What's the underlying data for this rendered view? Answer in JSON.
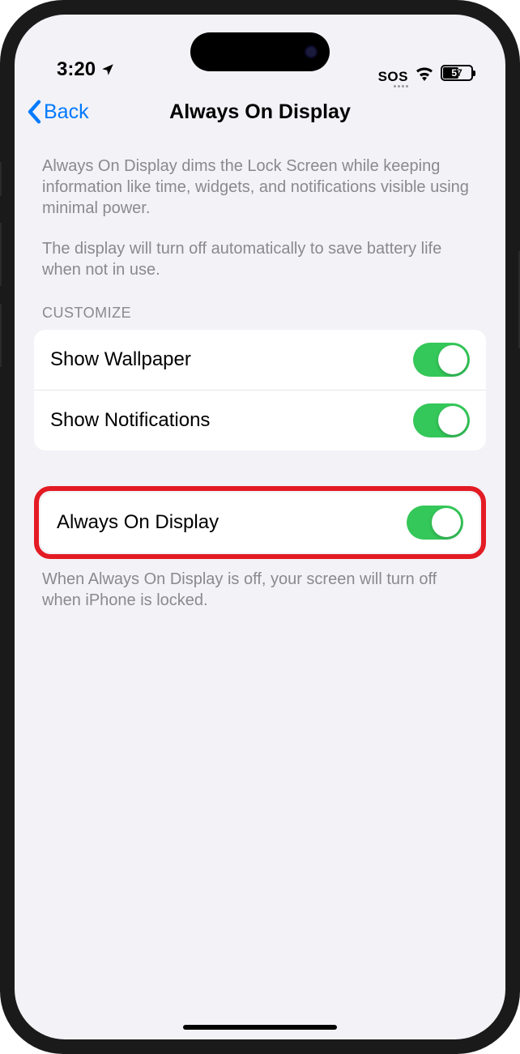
{
  "statusBar": {
    "time": "3:20",
    "sos": "SOS",
    "battery": "57"
  },
  "nav": {
    "back": "Back",
    "title": "Always On Display"
  },
  "descriptions": {
    "intro": "Always On Display dims the Lock Screen while keeping information like time, widgets, and notifications visible using minimal power.",
    "autoOff": "The display will turn off automatically to save battery life when not in use.",
    "footer": "When Always On Display is off, your screen will turn off when iPhone is locked."
  },
  "sections": {
    "customize": "CUSTOMIZE"
  },
  "settings": {
    "showWallpaper": {
      "label": "Show Wallpaper",
      "on": true
    },
    "showNotifications": {
      "label": "Show Notifications",
      "on": true
    },
    "alwaysOn": {
      "label": "Always On Display",
      "on": true
    }
  }
}
